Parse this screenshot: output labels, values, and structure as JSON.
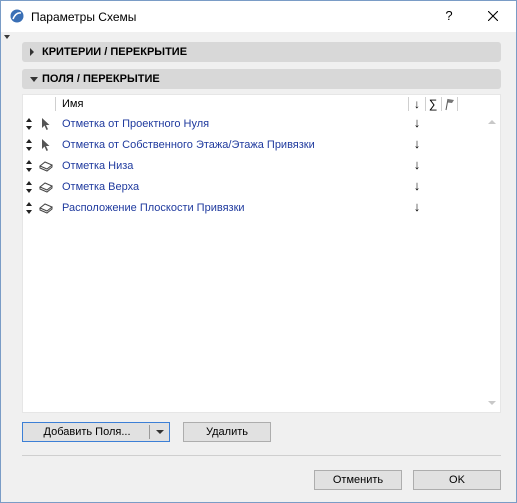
{
  "window": {
    "title": "Параметры Схемы",
    "help_label": "?",
    "close_icon": "close-icon",
    "app_icon": "archicad-icon"
  },
  "sections": {
    "criteria": {
      "label": "КРИТЕРИИ /  ПЕРЕКРЫТИЕ",
      "expanded": false
    },
    "fields": {
      "label": "ПОЛЯ /  ПЕРЕКРЫТИЕ",
      "expanded": true
    }
  },
  "list": {
    "header": {
      "name_label": "Имя",
      "sort_icon": "sort-arrow-icon",
      "sum_label": "∑",
      "flag_icon": "flag-icon"
    },
    "rows": [
      {
        "name": "Отметка от Проектного Нуля",
        "type_icon": "pointer-icon",
        "sort": "↓"
      },
      {
        "name": "Отметка от Собственного Этажа/Этажа Привязки",
        "type_icon": "pointer-icon",
        "sort": "↓"
      },
      {
        "name": "Отметка Низа",
        "type_icon": "slab-icon",
        "sort": "↓"
      },
      {
        "name": "Отметка Верха",
        "type_icon": "slab-icon",
        "sort": "↓"
      },
      {
        "name": "Расположение Плоскости Привязки",
        "type_icon": "slab-icon",
        "sort": "↓"
      }
    ]
  },
  "buttons": {
    "add_fields": "Добавить Поля...",
    "delete": "Удалить",
    "cancel": "Отменить",
    "ok": "OK"
  },
  "colors": {
    "accent": "#1f3a9e",
    "section_bg": "#d8d8d8",
    "focus_border": "#3c7fd6"
  }
}
